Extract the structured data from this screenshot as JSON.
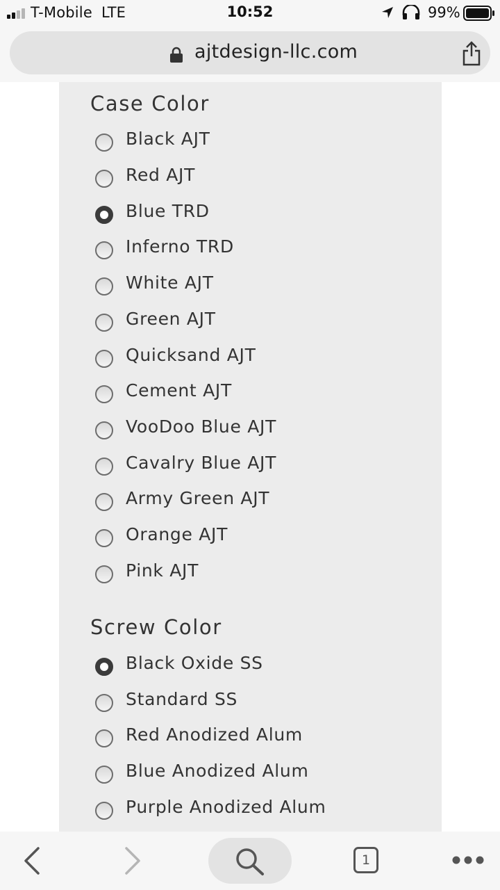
{
  "status_bar": {
    "carrier": "T-Mobile",
    "network": "LTE",
    "time": "10:52",
    "battery_percent": "99%"
  },
  "address_bar": {
    "url": "ajtdesign-llc.com"
  },
  "case_color": {
    "title": "Case Color",
    "options": [
      {
        "label": "Black AJT",
        "selected": false
      },
      {
        "label": "Red AJT",
        "selected": false
      },
      {
        "label": "Blue TRD",
        "selected": true
      },
      {
        "label": "Inferno TRD",
        "selected": false
      },
      {
        "label": "White AJT",
        "selected": false
      },
      {
        "label": "Green AJT",
        "selected": false
      },
      {
        "label": "Quicksand AJT",
        "selected": false
      },
      {
        "label": "Cement AJT",
        "selected": false
      },
      {
        "label": "VooDoo Blue AJT",
        "selected": false
      },
      {
        "label": "Cavalry Blue AJT",
        "selected": false
      },
      {
        "label": "Army Green AJT",
        "selected": false
      },
      {
        "label": "Orange AJT",
        "selected": false
      },
      {
        "label": "Pink AJT",
        "selected": false
      }
    ]
  },
  "screw_color": {
    "title": "Screw Color",
    "options": [
      {
        "label": "Black Oxide SS",
        "selected": true
      },
      {
        "label": "Standard SS",
        "selected": false
      },
      {
        "label": "Red Anodized Alum",
        "selected": false
      },
      {
        "label": "Blue Anodized Alum",
        "selected": false
      },
      {
        "label": "Purple Anodized Alum",
        "selected": false
      }
    ]
  },
  "toolbar": {
    "tab_count": "1"
  },
  "colors": {
    "panel_bg": "#ececec",
    "text": "#333333",
    "radio_checked": "#3b3b3b"
  }
}
